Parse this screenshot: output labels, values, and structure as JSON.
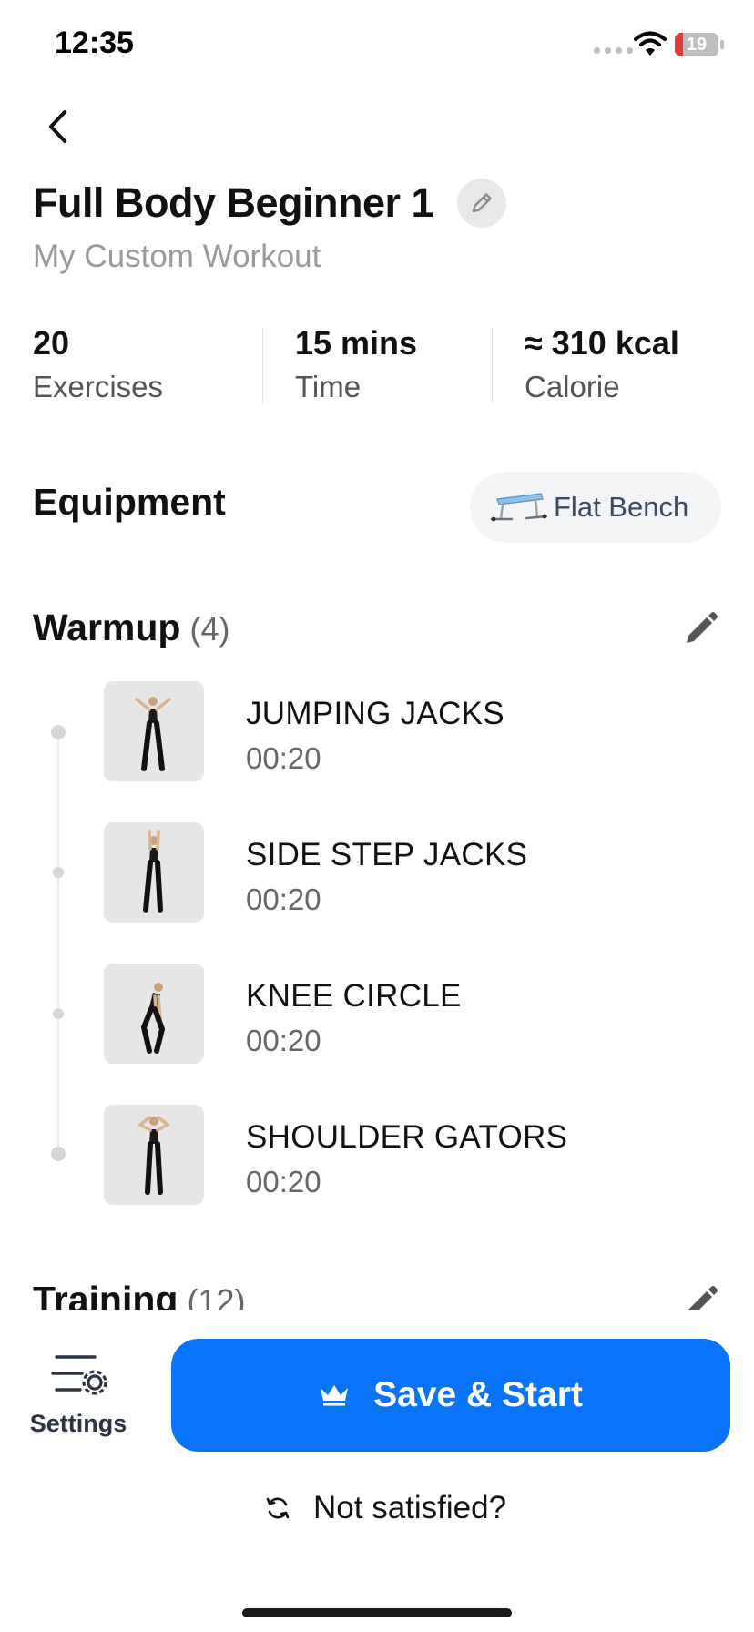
{
  "status_bar": {
    "time": "12:35",
    "battery_level": "19",
    "battery_fraction": 0.19
  },
  "header": {
    "back_icon": "chevron-left-icon",
    "title": "Full Body Beginner 1",
    "edit_icon": "pencil-outline-icon",
    "subtitle": "My Custom Workout"
  },
  "stats": [
    {
      "value": "20",
      "label": "Exercises"
    },
    {
      "value": "15 mins",
      "label": "Time"
    },
    {
      "value": "≈ 310 kcal",
      "label": "Calorie"
    }
  ],
  "equipment": {
    "title": "Equipment",
    "chip": {
      "label": "Flat Bench",
      "icon": "flat-bench-icon"
    }
  },
  "warmup": {
    "title": "Warmup",
    "count": "(4)",
    "edit_icon": "pencil-icon",
    "exercises": [
      {
        "name": "JUMPING JACKS",
        "duration": "00:20"
      },
      {
        "name": "SIDE STEP JACKS",
        "duration": "00:20"
      },
      {
        "name": "KNEE CIRCLE",
        "duration": "00:20"
      },
      {
        "name": "SHOULDER GATORS",
        "duration": "00:20"
      }
    ]
  },
  "training": {
    "title": "Training",
    "count": "(12)",
    "edit_icon": "pencil-icon"
  },
  "bottom_bar": {
    "settings_label": "Settings",
    "settings_icon": "settings-sliders-icon",
    "primary_label": "Save & Start",
    "primary_icon": "crown-icon",
    "secondary_label": "Not satisfied?",
    "secondary_icon": "refresh-icon"
  },
  "colors": {
    "primary": "#0a74f8",
    "text": "#111111",
    "muted": "#9a9a9a",
    "chip_bg": "#f3f4f6",
    "battery_low": "#e53935"
  }
}
